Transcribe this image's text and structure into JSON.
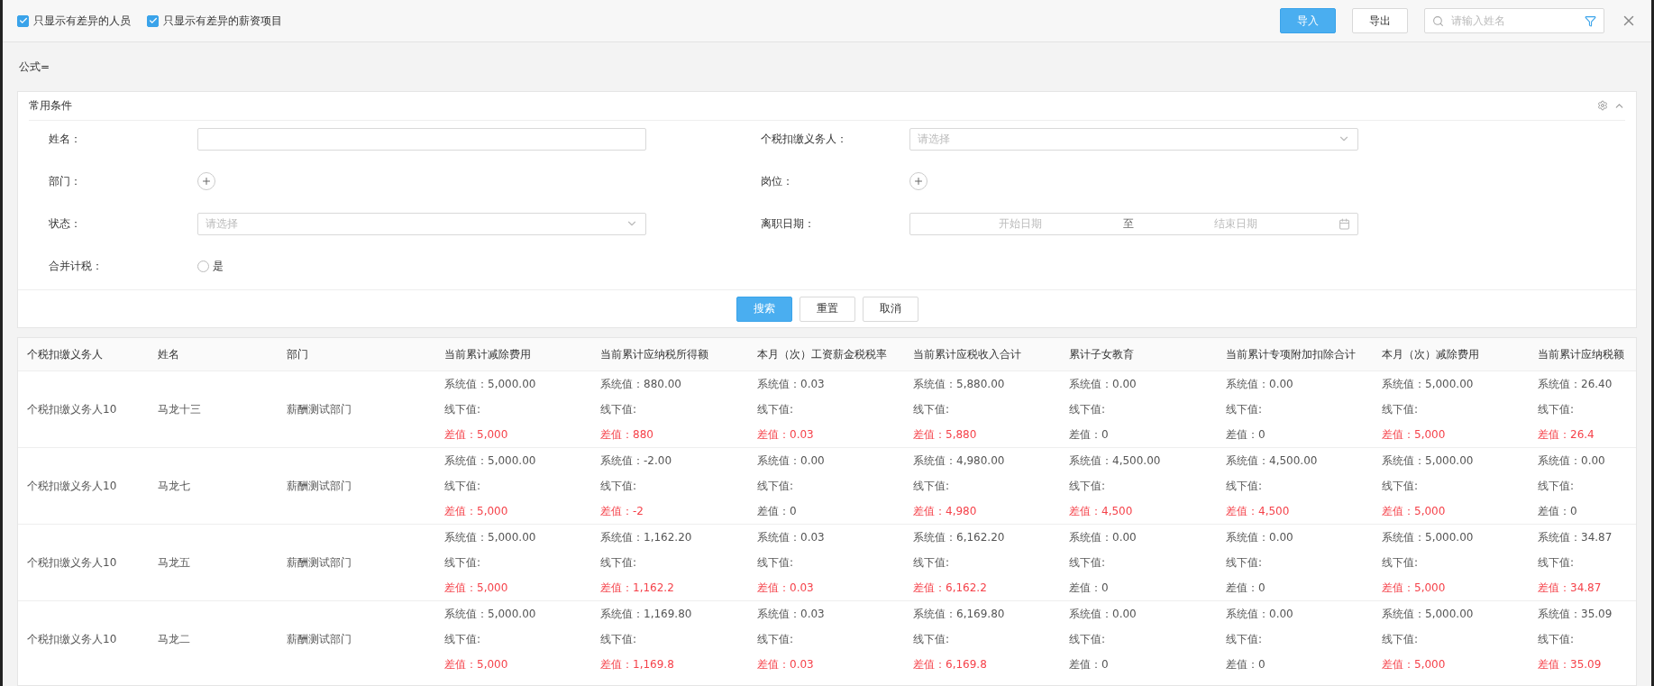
{
  "toolbar": {
    "checkboxes": [
      {
        "label": "只显示有差异的人员",
        "checked": true
      },
      {
        "label": "只显示有差异的薪资项目",
        "checked": true
      }
    ],
    "import_button": "导入",
    "export_button": "导出",
    "search": {
      "placeholder": "请输入姓名"
    }
  },
  "formula": "公式=",
  "filter_panel": {
    "title": "常用条件",
    "fields": [
      {
        "label": "姓名：",
        "kind": "text"
      },
      {
        "label": "个税扣缴义务人：",
        "kind": "select",
        "placeholder": "请选择"
      },
      {
        "label": "部门：",
        "kind": "add"
      },
      {
        "label": "岗位：",
        "kind": "add"
      },
      {
        "label": "状态：",
        "kind": "select",
        "placeholder": "请选择"
      },
      {
        "label": "离职日期：",
        "kind": "date",
        "start": "开始日期",
        "separator": "至",
        "end": "结束日期"
      },
      {
        "label": "合并计税：",
        "kind": "radio",
        "option": "是",
        "checked": false
      }
    ],
    "buttons": [
      {
        "label": "搜索",
        "primary": true
      },
      {
        "label": "重置",
        "primary": false
      },
      {
        "label": "取消",
        "primary": false
      }
    ]
  },
  "table": {
    "columns": [
      "个税扣缴义务人",
      "姓名",
      "部门",
      "当前累计减除费用",
      "当前累计应纳税所得额",
      "本月（次）工资薪金税税率",
      "当前累计应税收入合计",
      "累计子女教育",
      "当前累计专项附加扣除合计",
      "本月（次）减除费用",
      "当前累计应纳税额"
    ],
    "rows": [
      {
        "cells": [
          {
            "kind": "text",
            "text": "个税扣缴义务人10"
          },
          {
            "kind": "text",
            "text": "马龙十三"
          },
          {
            "kind": "text",
            "text": "薪酬测试部门"
          },
          {
            "kind": "compare",
            "system": "系统值：5,000.00",
            "offline": "线下值:",
            "diff": "差值：5,000",
            "mismatch": true
          },
          {
            "kind": "compare",
            "system": "系统值：880.00",
            "offline": "线下值:",
            "diff": "差值：880",
            "mismatch": true
          },
          {
            "kind": "compare",
            "system": "系统值：0.03",
            "offline": "线下值:",
            "diff": "差值：0.03",
            "mismatch": true
          },
          {
            "kind": "compare",
            "system": "系统值：5,880.00",
            "offline": "线下值:",
            "diff": "差值：5,880",
            "mismatch": true
          },
          {
            "kind": "compare",
            "system": "系统值：0.00",
            "offline": "线下值:",
            "diff": "差值：0",
            "mismatch": false
          },
          {
            "kind": "compare",
            "system": "系统值：0.00",
            "offline": "线下值:",
            "diff": "差值：0",
            "mismatch": false
          },
          {
            "kind": "compare",
            "system": "系统值：5,000.00",
            "offline": "线下值:",
            "diff": "差值：5,000",
            "mismatch": true
          },
          {
            "kind": "compare",
            "system": "系统值：26.40",
            "offline": "线下值:",
            "diff": "差值：26.4",
            "mismatch": true
          }
        ]
      },
      {
        "cells": [
          {
            "kind": "text",
            "text": "个税扣缴义务人10"
          },
          {
            "kind": "text",
            "text": "马龙七"
          },
          {
            "kind": "text",
            "text": "薪酬测试部门"
          },
          {
            "kind": "compare",
            "system": "系统值：5,000.00",
            "offline": "线下值:",
            "diff": "差值：5,000",
            "mismatch": true
          },
          {
            "kind": "compare",
            "system": "系统值：-2.00",
            "offline": "线下值:",
            "diff": "差值：-2",
            "mismatch": true
          },
          {
            "kind": "compare",
            "system": "系统值：0.00",
            "offline": "线下值:",
            "diff": "差值：0",
            "mismatch": false
          },
          {
            "kind": "compare",
            "system": "系统值：4,980.00",
            "offline": "线下值:",
            "diff": "差值：4,980",
            "mismatch": true
          },
          {
            "kind": "compare",
            "system": "系统值：4,500.00",
            "offline": "线下值:",
            "diff": "差值：4,500",
            "mismatch": true
          },
          {
            "kind": "compare",
            "system": "系统值：4,500.00",
            "offline": "线下值:",
            "diff": "差值：4,500",
            "mismatch": true
          },
          {
            "kind": "compare",
            "system": "系统值：5,000.00",
            "offline": "线下值:",
            "diff": "差值：5,000",
            "mismatch": true
          },
          {
            "kind": "compare",
            "system": "系统值：0.00",
            "offline": "线下值:",
            "diff": "差值：0",
            "mismatch": false
          }
        ]
      },
      {
        "cells": [
          {
            "kind": "text",
            "text": "个税扣缴义务人10"
          },
          {
            "kind": "text",
            "text": "马龙五"
          },
          {
            "kind": "text",
            "text": "薪酬测试部门"
          },
          {
            "kind": "compare",
            "system": "系统值：5,000.00",
            "offline": "线下值:",
            "diff": "差值：5,000",
            "mismatch": true
          },
          {
            "kind": "compare",
            "system": "系统值：1,162.20",
            "offline": "线下值:",
            "diff": "差值：1,162.2",
            "mismatch": true
          },
          {
            "kind": "compare",
            "system": "系统值：0.03",
            "offline": "线下值:",
            "diff": "差值：0.03",
            "mismatch": true
          },
          {
            "kind": "compare",
            "system": "系统值：6,162.20",
            "offline": "线下值:",
            "diff": "差值：6,162.2",
            "mismatch": true
          },
          {
            "kind": "compare",
            "system": "系统值：0.00",
            "offline": "线下值:",
            "diff": "差值：0",
            "mismatch": false
          },
          {
            "kind": "compare",
            "system": "系统值：0.00",
            "offline": "线下值:",
            "diff": "差值：0",
            "mismatch": false
          },
          {
            "kind": "compare",
            "system": "系统值：5,000.00",
            "offline": "线下值:",
            "diff": "差值：5,000",
            "mismatch": true
          },
          {
            "kind": "compare",
            "system": "系统值：34.87",
            "offline": "线下值:",
            "diff": "差值：34.87",
            "mismatch": true
          }
        ]
      },
      {
        "cells": [
          {
            "kind": "text",
            "text": "个税扣缴义务人10"
          },
          {
            "kind": "text",
            "text": "马龙二"
          },
          {
            "kind": "text",
            "text": "薪酬测试部门"
          },
          {
            "kind": "compare",
            "system": "系统值：5,000.00",
            "offline": "线下值:",
            "diff": "差值：5,000",
            "mismatch": true
          },
          {
            "kind": "compare",
            "system": "系统值：1,169.80",
            "offline": "线下值:",
            "diff": "差值：1,169.8",
            "mismatch": true
          },
          {
            "kind": "compare",
            "system": "系统值：0.03",
            "offline": "线下值:",
            "diff": "差值：0.03",
            "mismatch": true
          },
          {
            "kind": "compare",
            "system": "系统值：6,169.80",
            "offline": "线下值:",
            "diff": "差值：6,169.8",
            "mismatch": true
          },
          {
            "kind": "compare",
            "system": "系统值：0.00",
            "offline": "线下值:",
            "diff": "差值：0",
            "mismatch": false
          },
          {
            "kind": "compare",
            "system": "系统值：0.00",
            "offline": "线下值:",
            "diff": "差值：0",
            "mismatch": false
          },
          {
            "kind": "compare",
            "system": "系统值：5,000.00",
            "offline": "线下值:",
            "diff": "差值：5,000",
            "mismatch": true
          },
          {
            "kind": "compare",
            "system": "系统值：35.09",
            "offline": "线下值:",
            "diff": "差值：35.09",
            "mismatch": true
          }
        ]
      }
    ]
  }
}
